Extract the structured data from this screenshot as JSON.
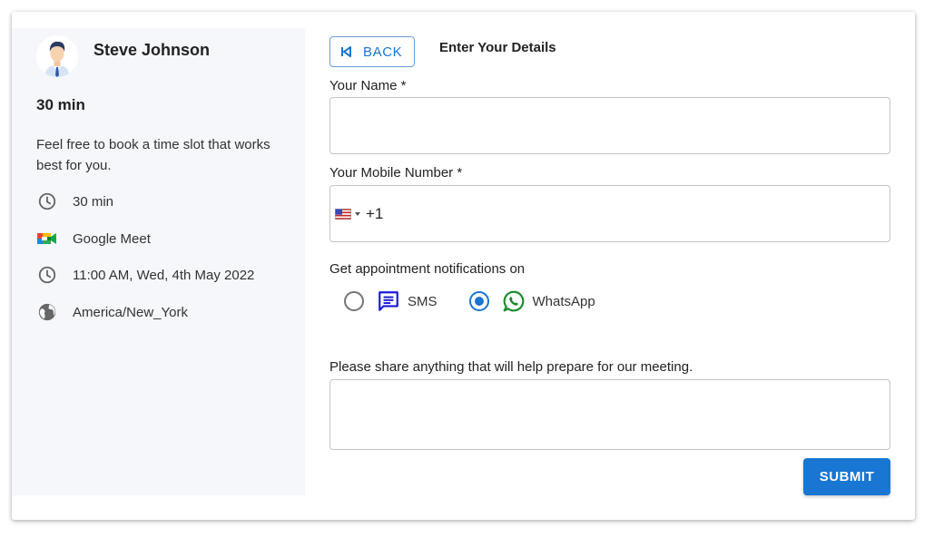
{
  "host": {
    "name": "Steve Johnson",
    "avatar_icon": "person-avatar-icon"
  },
  "event": {
    "duration_title": "30 min",
    "description": "Feel free to book a time slot that works best for you.",
    "details": [
      {
        "icon": "clock-icon",
        "text": "30 min"
      },
      {
        "icon": "google-meet-icon",
        "text": "Google Meet"
      },
      {
        "icon": "clock-icon",
        "text": "11:00 AM, Wed, 4th May 2022"
      },
      {
        "icon": "globe-icon",
        "text": "America/New_York"
      }
    ]
  },
  "form": {
    "back_label": "BACK",
    "heading": "Enter Your Details",
    "name_label": "Your Name *",
    "name_value": "",
    "mobile_label": "Your Mobile Number *",
    "country_flag": "us-flag-icon",
    "dial_code": "+1",
    "mobile_value": "",
    "notifications_label": "Get appointment notifications on",
    "notification_options": [
      {
        "label": "SMS",
        "icon": "sms-icon",
        "checked": false
      },
      {
        "label": "WhatsApp",
        "icon": "whatsapp-icon",
        "checked": true
      }
    ],
    "notes_label": "Please share anything that will help prepare for our meeting.",
    "notes_value": "",
    "submit_label": "SUBMIT"
  },
  "colors": {
    "primary": "#1976d2",
    "left_panel_bg": "#f5f7fb",
    "sms_icon": "#1a1ad6",
    "whatsapp_icon": "#1b8a2e"
  }
}
